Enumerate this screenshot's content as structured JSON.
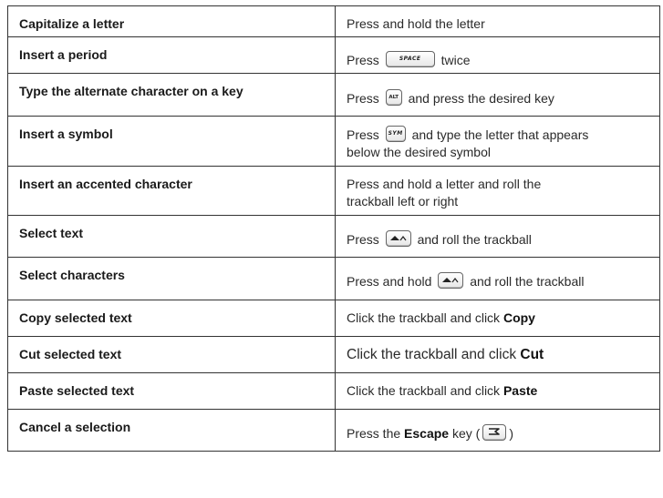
{
  "rows": [
    {
      "action": "Capitalize a letter",
      "how": "Press and hold the letter"
    },
    {
      "action": "Insert a period",
      "how_pre": "Press",
      "key": "SPACE",
      "how_post": "twice"
    },
    {
      "action": "Type the alternate character on a key",
      "how_pre": "Press",
      "key": "ALT",
      "how_post": "and press the desired key"
    },
    {
      "action": "Insert a symbol",
      "how_pre": "Press",
      "key": "SYM",
      "how_post": "and type the letter that appears",
      "how_line2": "below the desired symbol"
    },
    {
      "action": "Insert an accented character",
      "how": "Press and hold a letter and roll the",
      "how_line2": "trackball left or right"
    },
    {
      "action": "Select text",
      "how_pre": "Press",
      "key_icon": "shift-key-icon",
      "how_post": "and roll the trackball"
    },
    {
      "action": "Select characters",
      "how_pre": "Press and hold",
      "key_icon": "shift-key-icon",
      "how_post": "and roll the trackball"
    },
    {
      "action": "Copy selected text",
      "how_pre": "Click the trackball and click",
      "how_bold": "Copy"
    },
    {
      "action": "Cut selected text",
      "how_pre": "Click the trackball and click",
      "how_bold": "Cut"
    },
    {
      "action": "Paste selected text",
      "how_pre": "Click the trackball and click",
      "how_bold": "Paste"
    },
    {
      "action": "Cancel a selection",
      "how_pre": "Press the",
      "how_bold": "Escape",
      "how_post": "key (",
      "key_icon": "escape-key-icon",
      "how_end": ")"
    }
  ]
}
